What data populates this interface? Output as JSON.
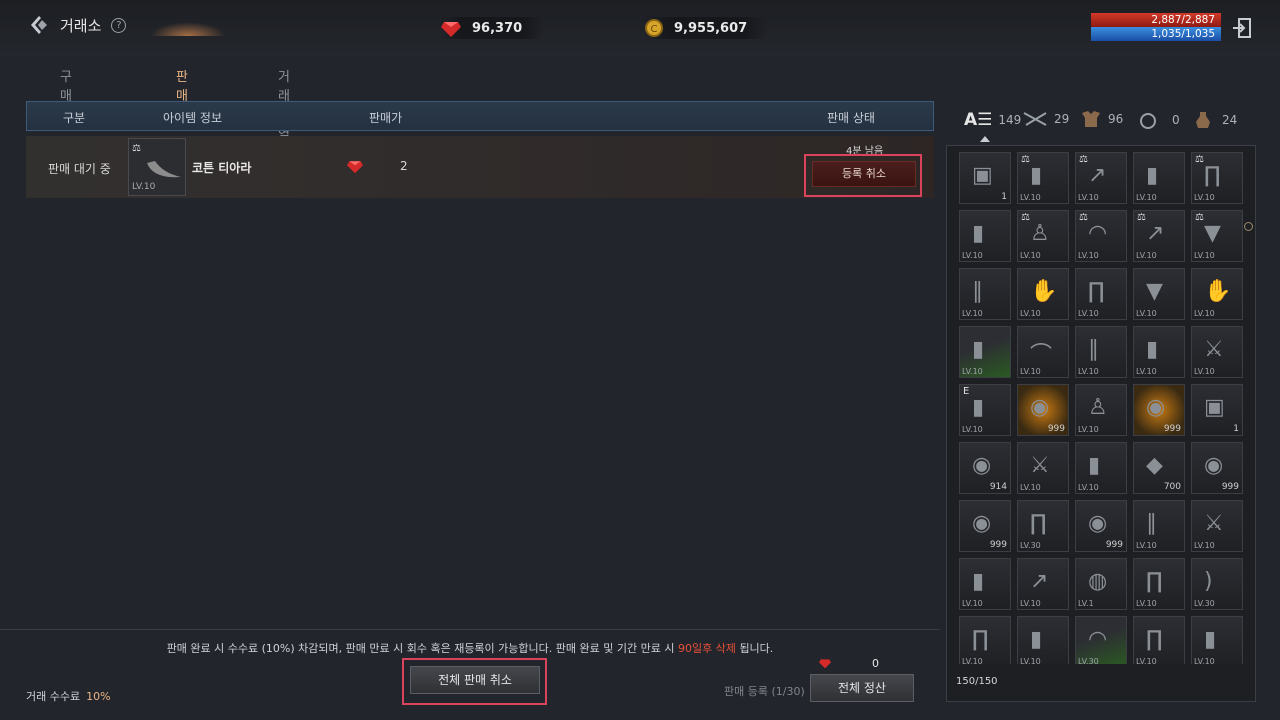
{
  "header": {
    "title": "거래소",
    "help": "?",
    "ruby": "96,370",
    "gold": "9,955,607",
    "hp": "2,887/2,887",
    "mp": "1,035/1,035"
  },
  "tabs": [
    "구매",
    "판매",
    "거래 내역"
  ],
  "table": {
    "columns": [
      "구분",
      "아이템 정보",
      "판매가",
      "판매 상태"
    ],
    "rows": [
      {
        "status": "판매 대기 중",
        "item_name": "코튼 티아라",
        "item_level": "LV.10",
        "price": "2",
        "time_left": "4분 남음",
        "cancel_label": "등록 취소"
      }
    ]
  },
  "footer": {
    "notice_a": "판매 완료 시 수수료 (10%) 차감되며, 판매 만료 시 회수 혹은 재등록이 가능합니다. 판매 완료 및 기간 만료 시",
    "notice_red": "90일후 삭제",
    "notice_b": "됩니다.",
    "fee_label": "거래 수수료",
    "fee_value": "10%",
    "cancel_all": "전체 판매 취소",
    "reg_count": "판매 등록 (1/30)",
    "settle_value": "0",
    "settle_all": "전체 정산"
  },
  "inventory": {
    "tabs": [
      {
        "icon": "all-items-icon",
        "count": "149"
      },
      {
        "icon": "weapon-icon",
        "count": "29"
      },
      {
        "icon": "armor-icon",
        "count": "96"
      },
      {
        "icon": "accessory-icon",
        "count": "0"
      },
      {
        "icon": "consumable-icon",
        "count": "24"
      }
    ],
    "slots": [
      {
        "lv": "",
        "cnt": "1",
        "mark": "",
        "kind": "card"
      },
      {
        "lv": "LV.10",
        "cnt": "",
        "mark": "⚖",
        "kind": "armor"
      },
      {
        "lv": "LV.10",
        "cnt": "",
        "mark": "⚖",
        "kind": "spear"
      },
      {
        "lv": "LV.10",
        "cnt": "",
        "mark": "",
        "kind": "armor"
      },
      {
        "lv": "LV.10",
        "cnt": "",
        "mark": "⚖",
        "kind": "pants"
      },
      {
        "lv": "LV.10",
        "cnt": "",
        "mark": "",
        "kind": "armor"
      },
      {
        "lv": "LV.10",
        "cnt": "",
        "mark": "⚖",
        "kind": "shirt"
      },
      {
        "lv": "LV.10",
        "cnt": "",
        "mark": "⚖",
        "kind": "hat"
      },
      {
        "lv": "LV.10",
        "cnt": "",
        "mark": "⚖",
        "kind": "spear"
      },
      {
        "lv": "LV.10",
        "cnt": "",
        "mark": "⚖",
        "kind": "cape"
      },
      {
        "lv": "LV.10",
        "cnt": "",
        "mark": "",
        "kind": "boots"
      },
      {
        "lv": "LV.10",
        "cnt": "",
        "mark": "",
        "kind": "glove"
      },
      {
        "lv": "LV.10",
        "cnt": "",
        "mark": "",
        "kind": "pants"
      },
      {
        "lv": "LV.10",
        "cnt": "",
        "mark": "",
        "kind": "cape"
      },
      {
        "lv": "LV.10",
        "cnt": "",
        "mark": "",
        "kind": "glove"
      },
      {
        "lv": "LV.10",
        "cnt": "",
        "mark": "",
        "kind": "armor",
        "green": true
      },
      {
        "lv": "LV.10",
        "cnt": "",
        "mark": "",
        "kind": "tiara"
      },
      {
        "lv": "LV.10",
        "cnt": "",
        "mark": "",
        "kind": "boots"
      },
      {
        "lv": "LV.10",
        "cnt": "",
        "mark": "",
        "kind": "armor"
      },
      {
        "lv": "LV.10",
        "cnt": "",
        "mark": "",
        "kind": "sword"
      },
      {
        "lv": "LV.10",
        "cnt": "",
        "mark": "E",
        "kind": "armor"
      },
      {
        "lv": "",
        "cnt": "999",
        "mark": "",
        "kind": "coin",
        "gold": true
      },
      {
        "lv": "LV.10",
        "cnt": "",
        "mark": "",
        "kind": "shirt"
      },
      {
        "lv": "",
        "cnt": "999",
        "mark": "",
        "kind": "coin",
        "gold": true
      },
      {
        "lv": "",
        "cnt": "1",
        "mark": "",
        "kind": "card"
      },
      {
        "lv": "",
        "cnt": "914",
        "mark": "",
        "kind": "coin"
      },
      {
        "lv": "LV.10",
        "cnt": "",
        "mark": "",
        "kind": "sword"
      },
      {
        "lv": "LV.10",
        "cnt": "",
        "mark": "",
        "kind": "armor"
      },
      {
        "lv": "",
        "cnt": "700",
        "mark": "",
        "kind": "gem"
      },
      {
        "lv": "",
        "cnt": "999",
        "mark": "",
        "kind": "coin"
      },
      {
        "lv": "",
        "cnt": "999",
        "mark": "",
        "kind": "coin"
      },
      {
        "lv": "LV.30",
        "cnt": "",
        "mark": "",
        "kind": "pants"
      },
      {
        "lv": "",
        "cnt": "999",
        "mark": "",
        "kind": "coin"
      },
      {
        "lv": "LV.10",
        "cnt": "",
        "mark": "",
        "kind": "boots"
      },
      {
        "lv": "LV.10",
        "cnt": "",
        "mark": "",
        "kind": "sword"
      },
      {
        "lv": "LV.10",
        "cnt": "",
        "mark": "",
        "kind": "armor"
      },
      {
        "lv": "LV.10",
        "cnt": "",
        "mark": "",
        "kind": "spear"
      },
      {
        "lv": "LV.1",
        "cnt": "",
        "mark": "",
        "kind": "shield"
      },
      {
        "lv": "LV.10",
        "cnt": "",
        "mark": "",
        "kind": "pants"
      },
      {
        "lv": "LV.30",
        "cnt": "",
        "mark": "",
        "kind": "bow"
      },
      {
        "lv": "LV.10",
        "cnt": "",
        "mark": "",
        "kind": "pants"
      },
      {
        "lv": "LV.10",
        "cnt": "",
        "mark": "",
        "kind": "armor"
      },
      {
        "lv": "LV.30",
        "cnt": "",
        "mark": "",
        "kind": "hat",
        "green": true
      },
      {
        "lv": "LV.10",
        "cnt": "",
        "mark": "",
        "kind": "pants"
      },
      {
        "lv": "LV.10",
        "cnt": "",
        "mark": "",
        "kind": "armor"
      }
    ],
    "capacity": "150/150"
  }
}
